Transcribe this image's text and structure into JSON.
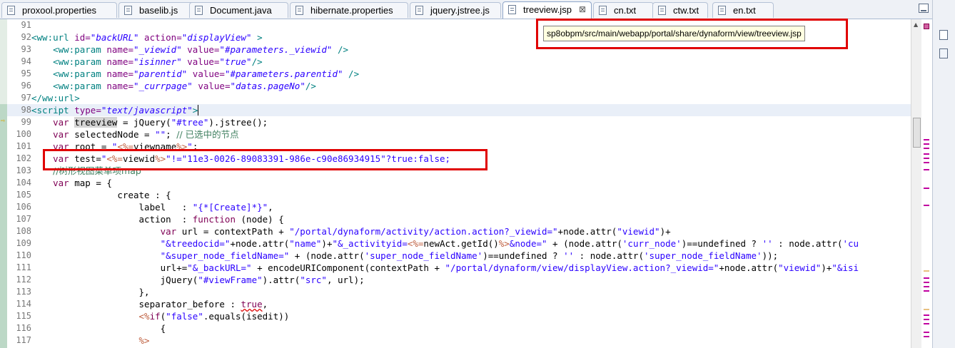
{
  "tabs": [
    {
      "label": "proxool.properties",
      "active": false
    },
    {
      "label": "baselib.js",
      "active": false
    },
    {
      "label": "Document.java",
      "active": false
    },
    {
      "label": "hibernate.properties",
      "active": false
    },
    {
      "label": "jquery.jstree.js",
      "active": false
    },
    {
      "label": "treeview.jsp",
      "active": true
    },
    {
      "label": "cn.txt",
      "active": false
    },
    {
      "label": "ctw.txt",
      "active": false
    },
    {
      "label": "en.txt",
      "active": false
    }
  ],
  "close_glyph": "⊠",
  "tooltip": "sp8obpm/src/main/webapp/portal/share/dynaform/view/treeview.jsp",
  "line_numbers": [
    "91",
    "92",
    "93",
    "94",
    "95",
    "96",
    "97",
    "98",
    "99",
    "100",
    "101",
    "102",
    "103",
    "104",
    "105",
    "106",
    "107",
    "108",
    "109",
    "110",
    "111",
    "112",
    "113",
    "114",
    "115",
    "116",
    "117"
  ],
  "code": {
    "l92": {
      "open": "<ww:url",
      "a1": " id=",
      "v1": "\"backURL\"",
      "a2": " action=",
      "v2": "\"displayView\"",
      "close": " >"
    },
    "l93": {
      "open": "    <ww:param",
      "a1": " name=",
      "v1": "\"_viewid\"",
      "a2": " value=",
      "v2": "\"#parameters._viewid\"",
      "close": " />"
    },
    "l94": {
      "open": "    <ww:param",
      "a1": " name=",
      "v1": "\"isinner\"",
      "a2": " value=",
      "v2": "\"true\"",
      "close": "/>"
    },
    "l95": {
      "open": "    <ww:param",
      "a1": " name=",
      "v1": "\"parentid\"",
      "a2": " value=",
      "v2": "\"#parameters.parentid\"",
      "close": " />"
    },
    "l96": {
      "open": "    <ww:param",
      "a1": " name=",
      "v1": "\"_currpage\"",
      "a2": " value=",
      "v2": "\"datas.pageNo\"",
      "close": "/>"
    },
    "l97": {
      "text": "</ww:url>"
    },
    "l98": {
      "open": "<script",
      "a1": " type=",
      "v1": "\"text/javascript\"",
      "close": ">"
    },
    "l99": {
      "indent": "    ",
      "kw": "var",
      "sp": " ",
      "var": "treeview",
      "mid": " = jQuery(",
      "s1": "\"#tree\"",
      "end": ").jstree();"
    },
    "l100": {
      "indent": "    ",
      "kw": "var",
      "mid": " selectedNode = ",
      "s1": "\"\"",
      "semi": "; ",
      "cmt": "// 已选中的节点"
    },
    "l101": {
      "indent": "    ",
      "kw": "var",
      "mid": " root = ",
      "q1": "\"",
      "scr1": "<%=",
      "body": "viewname",
      "scr2": "%>",
      "q2": "\"",
      "end": ";"
    },
    "l102": {
      "indent": "    ",
      "kw": "var",
      "mid": " test=",
      "q1": "\"",
      "scr1": "<%=",
      "body": "viewid",
      "scr2": "%>",
      "s1": "\"!=\"11e3-0026-89083391-986e-c90e86934915\"?true:false;"
    },
    "l103": {
      "indent": "    ",
      "cmt": "//树形视图菜单项map"
    },
    "l104": {
      "indent": "    ",
      "kw": "var",
      "mid": " map = {"
    },
    "l105": {
      "text": "                create : {"
    },
    "l106": {
      "text": "                    label   : ",
      "s1": "\"{*[Create]*}\"",
      "end": ","
    },
    "l107": {
      "text": "                    action  : ",
      "kw": "function",
      "end": " (node) {"
    },
    "l108": {
      "indent": "                        ",
      "kw": "var",
      "mid": " url = contextPath + ",
      "s1": "\"/portal/dynaform/activity/action.action?_viewid=\"",
      "end": "+node.attr(",
      "s2": "\"viewid\"",
      "end2": ")+"
    },
    "l109": {
      "indent": "                        ",
      "s1": "\"&treedocid=\"",
      "mid": "+node.attr(",
      "s2": "\"name\"",
      "mid2": ")+",
      "s3": "\"&_activityid=",
      "scr1": "<%=",
      "body": "newAct.getId()",
      "scr2": "%>",
      "s4": "&node=\"",
      "end": " + (node.attr(",
      "s5": "'curr_node'",
      "end2": ")==undefined ? ",
      "s6": "''",
      "end3": " : node.attr(",
      "s7": "'cu"
    },
    "l110": {
      "indent": "                        ",
      "s1": "\"&super_node_fieldName=\"",
      "mid": " + (node.attr(",
      "s2": "'super_node_fieldName'",
      "mid2": ")==undefined ? ",
      "s3": "''",
      "mid3": " : node.attr(",
      "s4": "'super_node_fieldName'",
      "end": "));"
    },
    "l111": {
      "indent": "                        ",
      "mid": "url+=",
      "s1": "\"&_backURL=\"",
      "mid2": " + encodeURIComponent(contextPath + ",
      "s2": "\"/portal/dynaform/view/displayView.action?_viewid=\"",
      "mid3": "+node.attr(",
      "s3": "\"viewid\"",
      "mid4": ")+",
      "s4": "\"&isi"
    },
    "l112": {
      "indent": "                        ",
      "mid": "jQuery(",
      "s1": "\"#viewFrame\"",
      "mid2": ").attr(",
      "s2": "\"src\"",
      "end": ", url);"
    },
    "l113": {
      "text": "                    },"
    },
    "l114": {
      "text": "                    separator_before : ",
      "kw": "true",
      "end": ","
    },
    "l115": {
      "indent": "                    ",
      "scr1": "<%",
      "kw": "if",
      "mid": "(",
      "s1": "\"false\"",
      "end": ".equals(isedit))"
    },
    "l116": {
      "text": "                        {"
    },
    "l117": {
      "indent": "                    ",
      "scr2": "%>"
    }
  }
}
